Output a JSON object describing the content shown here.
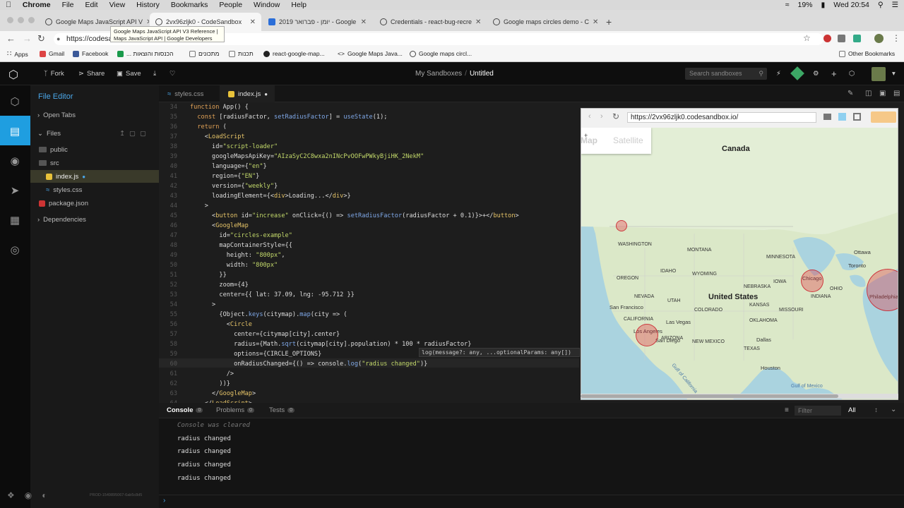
{
  "menubar": {
    "app": "Chrome",
    "items": [
      "File",
      "Edit",
      "View",
      "History",
      "Bookmarks",
      "People",
      "Window",
      "Help"
    ],
    "battery": "19%",
    "clock": "Wed 20:54"
  },
  "tabs": [
    {
      "title": "Google Maps JavaScript API V"
    },
    {
      "title": "2vx96zljk0 - CodeSandbox"
    },
    {
      "title": "2019 יומן - פברואר - Google"
    },
    {
      "title": "Credentials - react-bug-recre"
    },
    {
      "title": "Google maps circles demo - C"
    }
  ],
  "tooltip": {
    "line1": "Google Maps JavaScript API V3 Reference |",
    "line2": "Maps JavaScript API | Google Developers"
  },
  "address": {
    "url": "https://codesa"
  },
  "bookmarks": [
    "Apps",
    "Gmail",
    "Facebook",
    "... הכנסות והוצאות",
    "מתכונים",
    "תכנות",
    "react-google-map...",
    "Google Maps Java...",
    "Google maps circl..."
  ],
  "other_bookmarks": "Other Bookmarks",
  "header": {
    "fork": "Fork",
    "share": "Share",
    "save": "Save",
    "breadcrumb": "My Sandboxes",
    "separator": "/",
    "title": "Untitled",
    "search_placeholder": "Search sandboxes"
  },
  "sidebar": {
    "title": "File Editor",
    "open_tabs": "Open Tabs",
    "files": "Files",
    "public": "public",
    "src": "src",
    "index": "index.js",
    "styles": "styles.css",
    "package": "package.json",
    "dependencies": "Dependencies",
    "prod": "PROD-1549895067-6ab5c8d5"
  },
  "editor_tabs": [
    "styles.css",
    "index.js"
  ],
  "code_lines": [
    {
      "n": "34",
      "t": "function App() {"
    },
    {
      "n": "35",
      "t": "  const [radiusFactor, setRadiusFactor] = useState(1);"
    },
    {
      "n": "36",
      "t": "  return ("
    },
    {
      "n": "37",
      "t": "    <LoadScript"
    },
    {
      "n": "38",
      "t": "      id=\"script-loader\""
    },
    {
      "n": "39",
      "t": "      googleMapsApiKey=\"AIzaSyC2C8wxa2nINcPvOOFwPWkyBjiHK_2NekM\""
    },
    {
      "n": "40",
      "t": "      language={\"en\"}"
    },
    {
      "n": "41",
      "t": "      region={\"EN\"}"
    },
    {
      "n": "42",
      "t": "      version={\"weekly\"}"
    },
    {
      "n": "43",
      "t": "      loadingElement={<div>Loading...</div>}"
    },
    {
      "n": "44",
      "t": "    >"
    },
    {
      "n": "45",
      "t": "      <button id=\"increase\" onClick={() => setRadiusFactor(radiusFactor + 0.1)}>+</button>"
    },
    {
      "n": "46",
      "t": "      <GoogleMap"
    },
    {
      "n": "47",
      "t": "        id=\"circles-example\""
    },
    {
      "n": "48",
      "t": "        mapContainerStyle={{"
    },
    {
      "n": "49",
      "t": "          height: \"800px\","
    },
    {
      "n": "50",
      "t": "          width: \"800px\""
    },
    {
      "n": "51",
      "t": "        }}"
    },
    {
      "n": "52",
      "t": "        zoom={4}"
    },
    {
      "n": "53",
      "t": "        center={{ lat: 37.09, lng: -95.712 }}"
    },
    {
      "n": "54",
      "t": "      >"
    },
    {
      "n": "55",
      "t": "        {Object.keys(citymap).map(city => ("
    },
    {
      "n": "56",
      "t": "          <Circle"
    },
    {
      "n": "57",
      "t": "            center={citymap[city].center}"
    },
    {
      "n": "58",
      "t": "            radius={Math.sqrt(citymap[city].population) * 100 * radiusFactor}"
    },
    {
      "n": "59",
      "t": "            options={CIRCLE_OPTIONS}"
    },
    {
      "n": "60",
      "t": "            onRadiusChanged={() => console.log(\"radius changed\")}"
    },
    {
      "n": "61",
      "t": "          />"
    },
    {
      "n": "62",
      "t": "        ))}"
    },
    {
      "n": "63",
      "t": "      </GoogleMap>"
    },
    {
      "n": "64",
      "t": "    </LoadScript>"
    }
  ],
  "hint": "log(message?: any, ...optionalParams: any[])",
  "preview": {
    "url": "https://2vx96zljk0.codesandbox.io/",
    "map_tab": "Map",
    "satellite_tab": "Satellite"
  },
  "map_labels": {
    "canada": "Canada",
    "us": "United States",
    "washington": "WASHINGTON",
    "oregon": "OREGON",
    "idaho": "IDAHO",
    "montana": "MONTANA",
    "wyoming": "WYOMING",
    "nevada": "NEVADA",
    "utah": "UTAH",
    "colorado": "COLORADO",
    "california": "CALIFORNIA",
    "arizona": "ARIZONA",
    "new_mexico": "NEW MEXICO",
    "texas": "TEXAS",
    "oklahoma": "OKLAHOMA",
    "kansas": "KANSAS",
    "nebraska": "NEBRASKA",
    "iowa": "IOWA",
    "minnesota": "MINNESOTA",
    "missouri": "MISSOURI",
    "indiana": "INDIANA",
    "ohio": "OHIO",
    "sf": "San Francisco",
    "la": "Los Angeles",
    "sd": "San Diego",
    "lv": "Las Vegas",
    "dallas": "Dallas",
    "houston": "Houston",
    "chicago": "Chicago",
    "ottawa": "Ottawa",
    "toronto": "Toronto",
    "philly": "Philadelphia",
    "gulf": "Gulf of Mexico",
    "gulf_cal": "Gulf of California"
  },
  "panel": {
    "console": "Console",
    "problems": "Problems",
    "tests": "Tests",
    "count": "0",
    "filter": "Filter",
    "level": "All",
    "cleared": "Console was cleared",
    "log": "radius changed"
  }
}
